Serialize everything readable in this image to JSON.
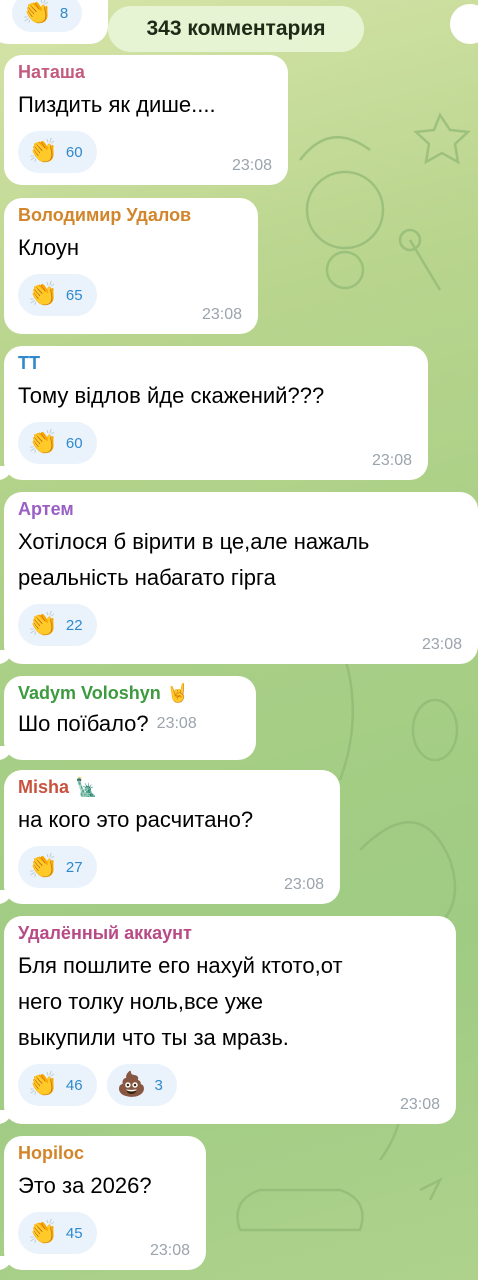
{
  "header": {
    "comments_count": "343 комментария"
  },
  "top_partial": {
    "reaction_icon": "👏",
    "reaction_count": "8"
  },
  "colors": {
    "reaction_count": "#2f89cc",
    "time": "#9aa4ad"
  },
  "messages": [
    {
      "author": "Наташа",
      "author_color": "#c35b7e",
      "author_emoji": "",
      "text": [
        "Пиздить як дише...."
      ],
      "reactions": [
        {
          "icon": "👏",
          "count": "60"
        }
      ],
      "time": "23:08"
    },
    {
      "author": "Володимир Удалов",
      "author_color": "#d2852a",
      "author_emoji": "",
      "text": [
        "Клоун"
      ],
      "reactions": [
        {
          "icon": "👏",
          "count": "65"
        }
      ],
      "time": "23:08"
    },
    {
      "author": "TT",
      "author_color": "#2f89cc",
      "author_emoji": "",
      "text": [
        "Тому відлов йде скажений???"
      ],
      "reactions": [
        {
          "icon": "👏",
          "count": "60"
        }
      ],
      "time": "23:08"
    },
    {
      "author": "Артем",
      "author_color": "#9a5fc5",
      "author_emoji": "",
      "text": [
        "Хотілося б вірити в це,але нажаль",
        "реальність набагато гірга"
      ],
      "reactions": [
        {
          "icon": "👏",
          "count": "22"
        }
      ],
      "time": "23:08"
    },
    {
      "author": "Vadym Voloshyn",
      "author_color": "#3c9a3f",
      "author_emoji": "🤘",
      "text": [
        "Шо поїбало?"
      ],
      "reactions": [],
      "time": "23:08"
    },
    {
      "author": "Misha",
      "author_color": "#c9523f",
      "author_emoji": "🗽",
      "text": [
        "на кого это расчитано?"
      ],
      "reactions": [
        {
          "icon": "👏",
          "count": "27"
        }
      ],
      "time": "23:08"
    },
    {
      "author": "Удалённый аккаунт",
      "author_color": "#b84b86",
      "author_emoji": "",
      "text": [
        "Бля пошлите его нахуй ктото,от",
        "него толку ноль,все уже",
        "выкупили что ты за мразь."
      ],
      "reactions": [
        {
          "icon": "👏",
          "count": "46"
        },
        {
          "icon": "💩",
          "count": "3"
        }
      ],
      "time": "23:08"
    },
    {
      "author": "Hopiloc",
      "author_color": "#d2852a",
      "author_emoji": "",
      "text": [
        "Это за 2026?"
      ],
      "reactions": [
        {
          "icon": "👏",
          "count": "45"
        }
      ],
      "time": "23:08"
    }
  ]
}
